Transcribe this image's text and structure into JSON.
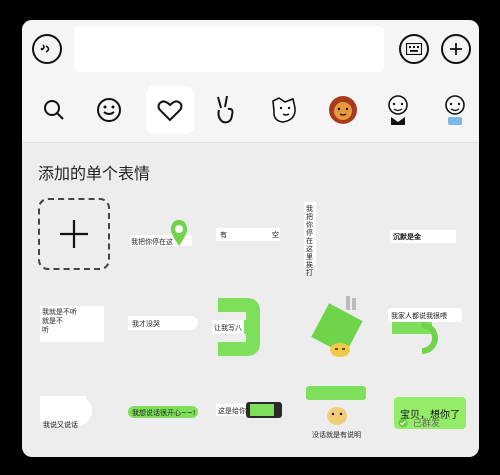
{
  "panel": {
    "section_title": "添加的单个表情"
  },
  "topbar": {
    "voice_icon": "voice-icon",
    "keyboard_icon": "keyboard-icon",
    "plus_icon": "plus-icon"
  },
  "tabs": [
    {
      "name": "search-icon"
    },
    {
      "name": "emoji-icon"
    },
    {
      "name": "heart-icon",
      "active": true
    },
    {
      "name": "victory-hand-icon"
    },
    {
      "name": "dog-sticker-icon"
    },
    {
      "name": "lion-sticker-icon"
    },
    {
      "name": "character-sticker-icon"
    },
    {
      "name": "blue-character-sticker-icon"
    }
  ],
  "stickers": {
    "s1": "我把你停在这",
    "s2a": "有",
    "s2b": "空",
    "s3": "我把你停在这里挨打",
    "s4": "沉默是金",
    "s5": "我就是不听\n就是不\n听",
    "s6": "我才没哭",
    "s7": "让我写八",
    "s8": "我家人都说我很喂",
    "s9": "我说又说话",
    "s10": "我想说话很开心~~!",
    "s11": "这是给你",
    "s12": "没话就是有说明",
    "bubble_text": "宝贝，想你了",
    "sent_label": "已群发"
  }
}
